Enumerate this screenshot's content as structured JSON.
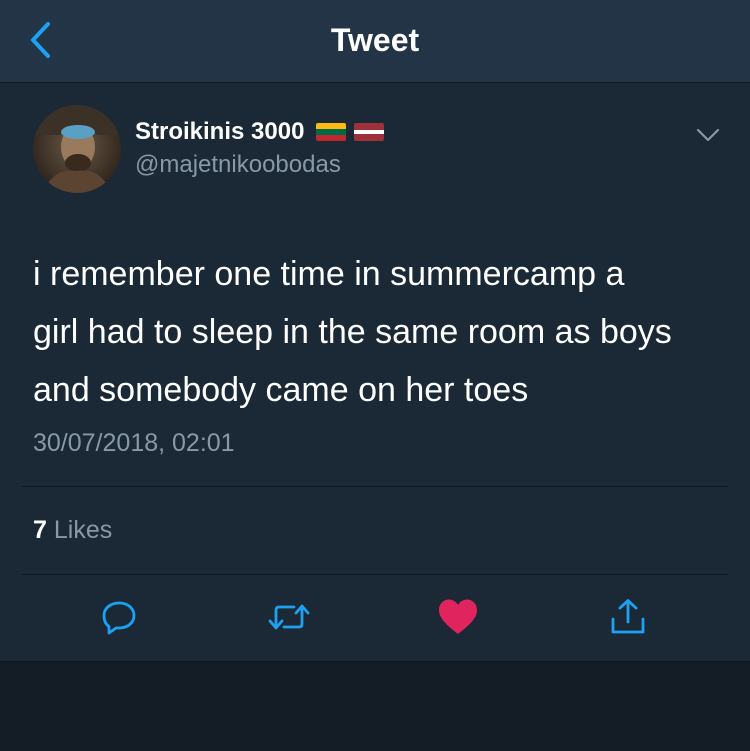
{
  "header": {
    "title": "Tweet",
    "back_icon": "chevron-left-icon"
  },
  "tweet": {
    "author": {
      "display_name": "Stroikinis 3000",
      "handle": "@majetnikoobodas",
      "flags": [
        "lithuania-flag",
        "latvia-flag"
      ]
    },
    "text_lines": [
      "i remember one time in summercamp a",
      "girl had to sleep in the same room as boys",
      "and somebody came on her toes"
    ],
    "timestamp": "30/07/2018, 02:01",
    "likes": {
      "count": "7",
      "label": "Likes"
    }
  },
  "actions": [
    {
      "name": "reply-icon",
      "color": "#1da1f2"
    },
    {
      "name": "retweet-icon",
      "color": "#1da1f2"
    },
    {
      "name": "like-icon",
      "color": "#e0245e",
      "active": true
    },
    {
      "name": "share-icon",
      "color": "#1da1f2"
    }
  ],
  "colors": {
    "accent": "#1da1f2",
    "like_active": "#e0245e",
    "header_bg": "#243447",
    "tweet_bg": "#1b2836",
    "secondary_text": "#8899a6"
  }
}
